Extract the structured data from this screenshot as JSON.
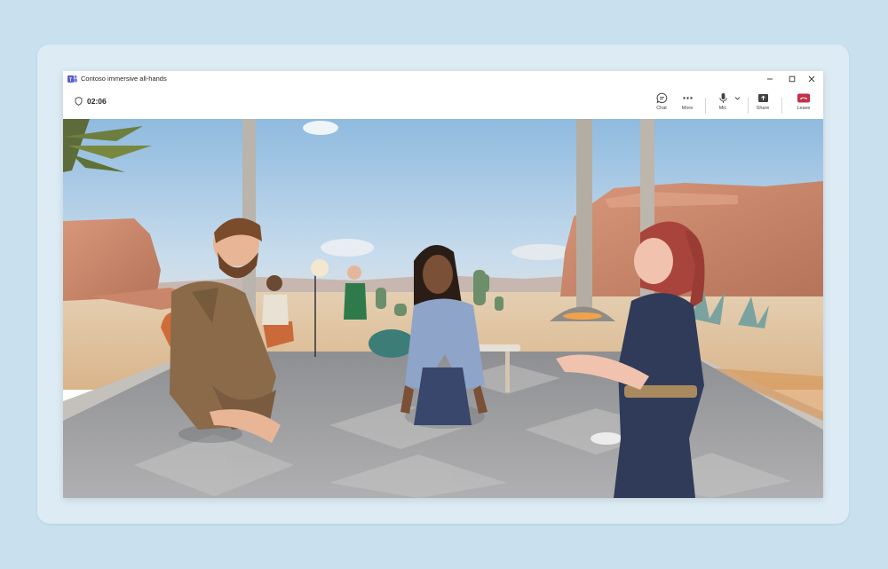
{
  "window": {
    "title": "Contoso immersive all-hands"
  },
  "meeting": {
    "timer": "02:06"
  },
  "toolbar": {
    "chat_label": "Chat",
    "more_label": "More",
    "mic_label": "Mic",
    "share_label": "Share",
    "leave_label": "Leave"
  },
  "colors": {
    "leave_accent": "#c4314b",
    "teams_brand": "#5b5fc7"
  },
  "icons": [
    "teams-logo-icon",
    "shield-icon",
    "chat-icon",
    "more-icon",
    "mic-icon",
    "chevron-down-icon",
    "share-icon",
    "leave-phone-icon",
    "minimize-icon",
    "maximize-icon",
    "close-icon"
  ]
}
